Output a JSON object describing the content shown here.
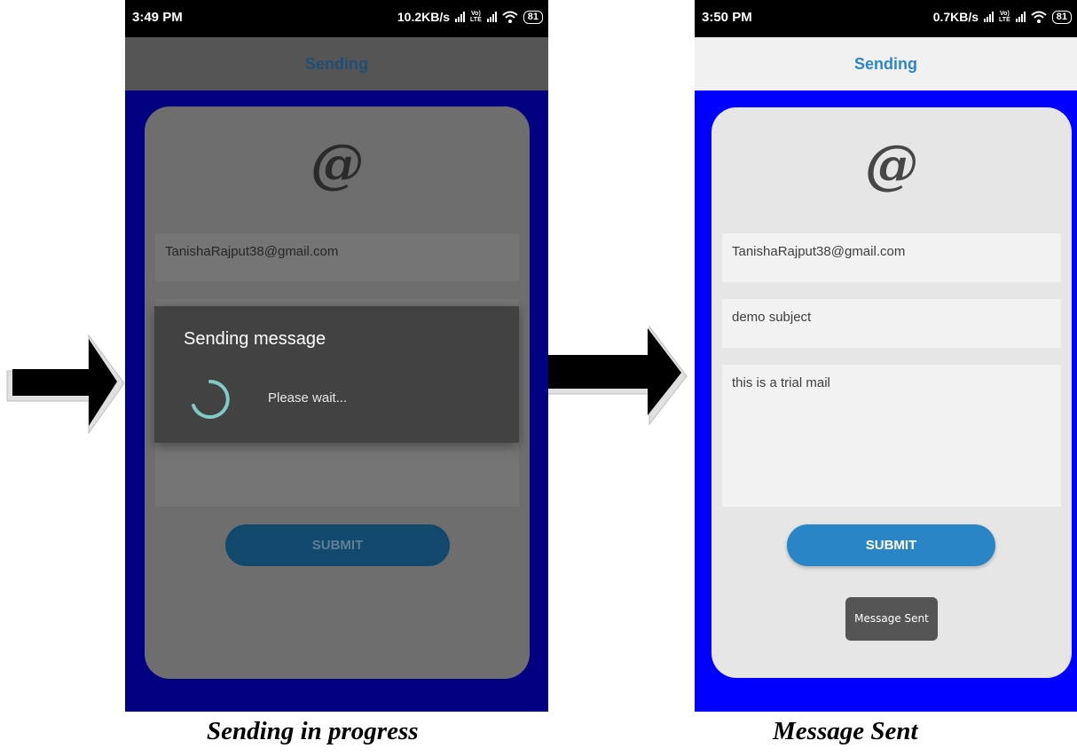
{
  "screens": {
    "left": {
      "status": {
        "time": "3:49 PM",
        "network_speed": "10.2KB/s",
        "volte_top": "Vo)",
        "volte_bottom": "LTE",
        "battery": "81"
      },
      "app_bar": {
        "title": "Sending"
      },
      "at_icon": "@",
      "fields": {
        "email_value": "TanishaRajput38@gmail.com",
        "subject_value": "",
        "message_value": ""
      },
      "submit_label": "SUBMIT",
      "dialog": {
        "title": "Sending message",
        "message": "Please wait..."
      }
    },
    "right": {
      "status": {
        "time": "3:50 PM",
        "network_speed": "0.7KB/s",
        "volte_top": "Vo)",
        "volte_bottom": "LTE",
        "battery": "81"
      },
      "app_bar": {
        "title": "Sending"
      },
      "at_icon": "@",
      "fields": {
        "email_value": "TanishaRajput38@gmail.com",
        "subject_value": "demo subject",
        "message_value": "this is a trial mail"
      },
      "submit_label": "SUBMIT",
      "toast": "Message Sent"
    }
  },
  "captions": {
    "left": "Sending in progress",
    "right": "Message Sent"
  },
  "colors": {
    "accent_blue": "#2985c5",
    "background_blue": "#0000ff",
    "dimmed_background": "#020080",
    "spinner": "#80cbc4"
  },
  "icons": [
    "arrow-right-icon",
    "signal-icon",
    "wifi-icon",
    "battery-icon",
    "at-icon",
    "spinner-icon"
  ]
}
